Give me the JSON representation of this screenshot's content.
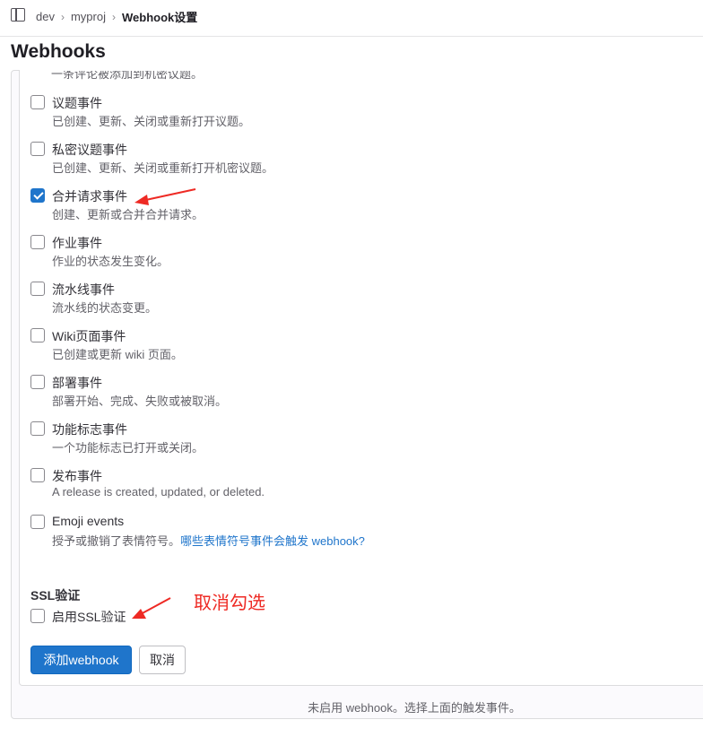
{
  "breadcrumb": {
    "items": [
      "dev",
      "myproj",
      "Webhook设置"
    ]
  },
  "page": {
    "title": "Webhooks"
  },
  "cut_off_desc": "一条评论被添加到机密议题。",
  "events": [
    {
      "label": "议题事件",
      "desc": "已创建、更新、关闭或重新打开议题。",
      "checked": false
    },
    {
      "label": "私密议题事件",
      "desc": "已创建、更新、关闭或重新打开机密议题。",
      "checked": false
    },
    {
      "label": "合并请求事件",
      "desc": "创建、更新或合并合并请求。",
      "checked": true
    },
    {
      "label": "作业事件",
      "desc": "作业的状态发生变化。",
      "checked": false
    },
    {
      "label": "流水线事件",
      "desc": "流水线的状态变更。",
      "checked": false
    },
    {
      "label": "Wiki页面事件",
      "desc": "已创建或更新 wiki 页面。",
      "checked": false
    },
    {
      "label": "部署事件",
      "desc": "部署开始、完成、失败或被取消。",
      "checked": false
    },
    {
      "label": "功能标志事件",
      "desc": "一个功能标志已打开或关闭。",
      "checked": false
    },
    {
      "label": "发布事件",
      "desc": "A release is created, updated, or deleted.",
      "checked": false
    },
    {
      "label": "Emoji events",
      "desc": "授予或撤销了表情符号。",
      "link": "哪些表情符号事件会触发 webhook?",
      "checked": false
    }
  ],
  "ssl": {
    "heading": "SSL验证",
    "label": "启用SSL验证",
    "checked": false
  },
  "annotation": {
    "note": "取消勾选",
    "color": "#ee2a24"
  },
  "buttons": {
    "add": "添加webhook",
    "cancel": "取消"
  },
  "footer": {
    "text": "未启用 webhook。选择上面的触发事件。"
  },
  "colors": {
    "primary": "#1f75cb"
  }
}
